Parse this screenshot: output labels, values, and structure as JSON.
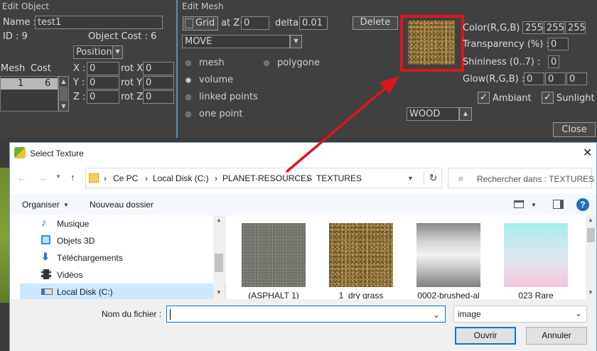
{
  "edit_object": {
    "title": "Edit Object",
    "name_label": "Name :",
    "name_value": "test1",
    "id_label": "ID : 9",
    "cost_label": "Object Cost : 6",
    "transform_mode": "Position",
    "mesh_col": "Mesh",
    "cost_col": "Cost",
    "mesh_rows": [
      {
        "mesh": "1",
        "cost": "6"
      }
    ],
    "x_label": "X :",
    "y_label": "Y :",
    "z_label": "Z :",
    "x_value": "0",
    "y_value": "0",
    "z_value": "0",
    "rotx_label": "rot X",
    "roty_label": "rot Y",
    "rotz_label": "rot Z",
    "rotx_value": "0",
    "roty_value": "0",
    "rotz_value": "0"
  },
  "edit_mesh": {
    "title": "Edit Mesh",
    "grid_label": "Grid",
    "at_label": "at Z=",
    "z_value": "0",
    "delta_label": "delta",
    "delta_value": "0.01",
    "delete_label": "Delete",
    "mode_value": "MOVE",
    "radio_mesh": "mesh",
    "radio_polygone": "polygone",
    "radio_volume": "volume",
    "radio_linked": "linked points",
    "radio_one": "one point",
    "color_label": "Color(R,G,B) :",
    "color_r": "255",
    "color_g": "255",
    "color_b": "255",
    "transparency_label": "Transparency (%) :",
    "transparency_value": "0",
    "shininess_label": "Shininess (0..7) :",
    "shininess_value": "0",
    "glow_label": "Glow(R,G,B) :",
    "glow_r": "0",
    "glow_g": "0",
    "glow_b": "0",
    "ambiant_label": "Ambiant",
    "sunlight_label": "Sunlight",
    "material_value": "WOOD",
    "close_label": "Close",
    "highlight_color": "#e0141e"
  },
  "dialog": {
    "title": "Select Texture",
    "breadcrumb": [
      "Ce PC",
      "Local Disk (C:)",
      "PLANET-RESOURCES",
      "TEXTURES"
    ],
    "search_placeholder": "Rechercher dans : TEXTURES",
    "organize_label": "Organiser",
    "new_folder_label": "Nouveau dossier",
    "nav_items": [
      {
        "label": "Musique",
        "icon": "music-icon"
      },
      {
        "label": "Objets 3D",
        "icon": "cube-icon"
      },
      {
        "label": "Téléchargements",
        "icon": "download-icon"
      },
      {
        "label": "Vidéos",
        "icon": "film-icon"
      },
      {
        "label": "Local Disk (C:)",
        "icon": "drive-icon"
      }
    ],
    "files": [
      {
        "name": "(ASPHALT 1)"
      },
      {
        "name": "1_dry grass"
      },
      {
        "name": "0002-brushed-al"
      },
      {
        "name": "023 Rare"
      }
    ],
    "filename_label": "Nom du fichier :",
    "filename_value": "",
    "filter_value": "image",
    "open_label": "Ouvrir",
    "cancel_label": "Annuler",
    "accent": "#0078d7"
  }
}
